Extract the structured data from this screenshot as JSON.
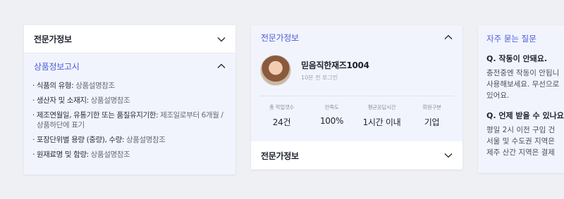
{
  "colors": {
    "accent": "#4b5bd6",
    "panel_bg": "#f2f4fd",
    "page_bg": "#eef0f4"
  },
  "card1": {
    "header_label": "전문가정보",
    "product_notice": {
      "title": "상품정보고시",
      "items": [
        {
          "key": "식품의 유형",
          "value": "상품설명참조"
        },
        {
          "key": "생산자 및 소재지",
          "value": "상품설명참조"
        },
        {
          "key": "제조연월일, 유통기한 또는 품질유지기한",
          "value": "제조일로부터 6개월 / 상품하단에 표기"
        },
        {
          "key": "포장단위별 용량 (중량), 수량",
          "value": "상품설명참조"
        },
        {
          "key": "원재료명 및 함량",
          "value": "상품설명참조"
        }
      ]
    }
  },
  "card2": {
    "header_label": "전문가정보",
    "profile": {
      "name": "믿음직한재즈1004",
      "last_login": "10분 전 로그인"
    },
    "stats": [
      {
        "label": "총 작업갯수",
        "value": "24건"
      },
      {
        "label": "만족도",
        "value": "100%"
      },
      {
        "label": "평균응답시간",
        "value": "1시간 이내"
      },
      {
        "label": "회원구분",
        "value": "기업"
      }
    ],
    "footer_label": "전문가정보"
  },
  "card3": {
    "title": "자주 묻는 질문",
    "faqs": [
      {
        "q": "Q. 작동이 안돼요.",
        "a_lines": [
          "충전중엔 작동이 안됩니",
          "사용해보세요. 무선으로",
          "있어요."
        ]
      },
      {
        "q": "Q. 언제 받을 수 있나요",
        "a_lines": [
          "평일 2시 이전 구입 건 ",
          "서울 및 수도권 지역은 ",
          "제주 산간 지역은 결제"
        ]
      }
    ]
  }
}
